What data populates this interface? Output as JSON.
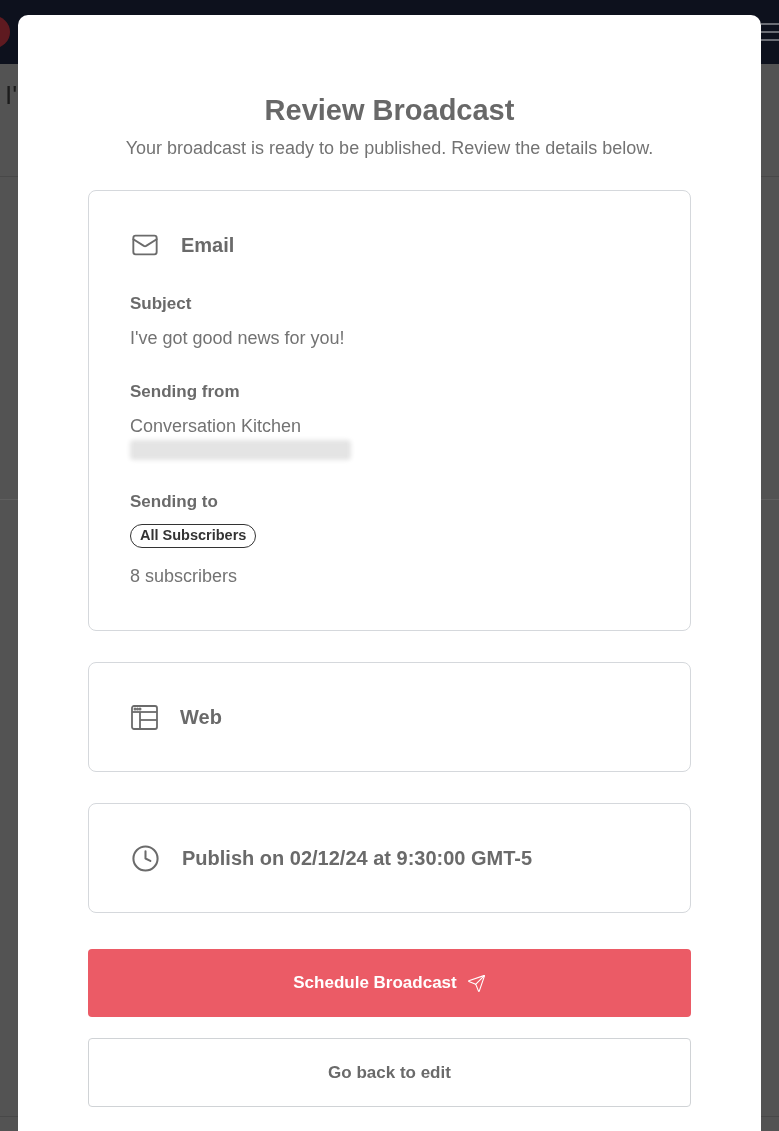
{
  "background_page": {
    "title": "I'"
  },
  "modal": {
    "title": "Review Broadcast",
    "subtitle": "Your broadcast is ready to be published. Review the details below."
  },
  "sections": [
    {
      "kind": "email",
      "heading": "Email",
      "fields": [
        {
          "kind": "text",
          "label": "Subject",
          "value": "I've got good news for you!"
        },
        {
          "kind": "sender",
          "label": "Sending from",
          "value": "Conversation Kitchen",
          "address_hidden": true
        },
        {
          "kind": "audience",
          "label": "Sending to",
          "tags": [
            "All Subscribers"
          ],
          "count": "8 subscribers"
        }
      ]
    },
    {
      "kind": "web",
      "heading": "Web"
    },
    {
      "kind": "schedule",
      "heading": "Publish on 02/12/24 at 9:30:00 GMT-5"
    }
  ],
  "buttons": [
    {
      "kind": "primary",
      "label": "Schedule Broadcast"
    },
    {
      "kind": "secondary",
      "label": "Go back to edit"
    }
  ]
}
